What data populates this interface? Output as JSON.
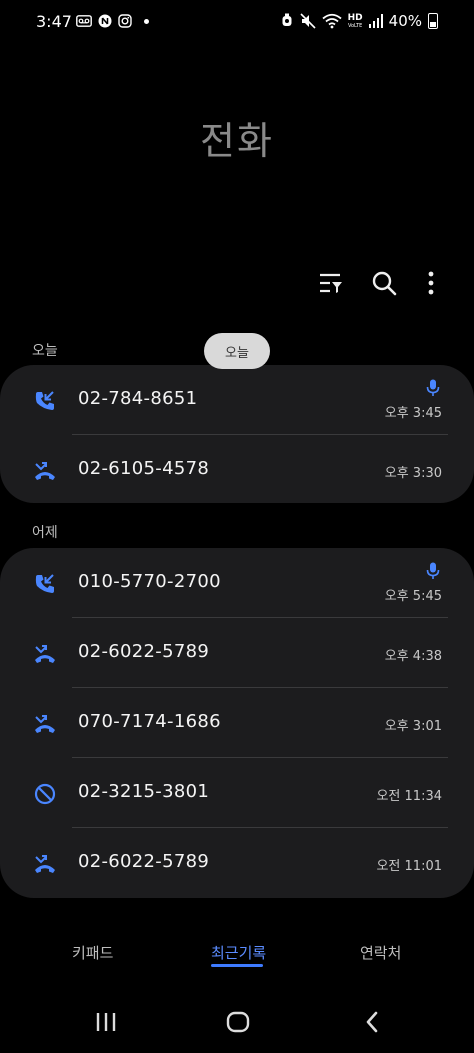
{
  "status_bar": {
    "time": "3:47",
    "battery": "40%",
    "hd_label": "HD",
    "volte_label": "VoLTE"
  },
  "app": {
    "title": "전화"
  },
  "toolbar": {
    "filter_icon": "filter-list-icon",
    "search_icon": "search-icon",
    "more_icon": "more-vertical-icon"
  },
  "floating_chip": "오늘",
  "sections": [
    {
      "label": "오늘",
      "calls": [
        {
          "type": "incoming",
          "icon": "incoming-call-icon",
          "number": "02-784-8651",
          "time": "오후 3:45",
          "recorded": true
        },
        {
          "type": "missed",
          "icon": "missed-call-icon",
          "number": "02-6105-4578",
          "time": "오후 3:30",
          "recorded": false
        }
      ]
    },
    {
      "label": "어제",
      "calls": [
        {
          "type": "incoming",
          "icon": "incoming-call-icon",
          "number": "010-5770-2700",
          "time": "오후 5:45",
          "recorded": true
        },
        {
          "type": "missed",
          "icon": "missed-call-icon",
          "number": "02-6022-5789",
          "time": "오후 4:38",
          "recorded": false
        },
        {
          "type": "missed",
          "icon": "missed-call-icon",
          "number": "070-7174-1686",
          "time": "오후 3:01",
          "recorded": false
        },
        {
          "type": "blocked",
          "icon": "blocked-call-icon",
          "number": "02-3215-3801",
          "time": "오전 11:34",
          "recorded": false
        },
        {
          "type": "missed",
          "icon": "missed-call-icon",
          "number": "02-6022-5789",
          "time": "오전 11:01",
          "recorded": false
        }
      ]
    }
  ],
  "tabs": [
    {
      "label": "키패드",
      "active": false
    },
    {
      "label": "최근기록",
      "active": true
    },
    {
      "label": "연락처",
      "active": false
    }
  ],
  "colors": {
    "accent": "#3e7bff",
    "icon_blue": "#4a86ff",
    "card_bg": "#1c1c1e",
    "background": "#000000"
  }
}
